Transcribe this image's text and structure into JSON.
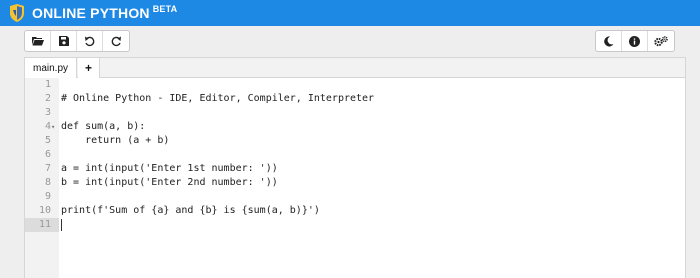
{
  "header": {
    "brand": "ONLINE PYTHON",
    "badge": "BETA",
    "accent_color": "#1e88e5"
  },
  "toolbar_left": {
    "buttons": [
      {
        "name": "open-folder-icon"
      },
      {
        "name": "save-icon"
      },
      {
        "name": "undo-icon"
      },
      {
        "name": "redo-icon"
      }
    ]
  },
  "toolbar_right": {
    "buttons": [
      {
        "name": "dark-mode-moon-icon"
      },
      {
        "name": "info-icon"
      },
      {
        "name": "settings-gears-icon"
      }
    ]
  },
  "tabs": {
    "file": "main.py",
    "add": "+"
  },
  "editor": {
    "lines": [
      {
        "n": "1",
        "text": ""
      },
      {
        "n": "2",
        "text": "# Online Python - IDE, Editor, Compiler, Interpreter"
      },
      {
        "n": "3",
        "text": ""
      },
      {
        "n": "4",
        "text": "def sum(a, b):"
      },
      {
        "n": "5",
        "text": "    return (a + b)"
      },
      {
        "n": "6",
        "text": ""
      },
      {
        "n": "7",
        "text": "a = int(input('Enter 1st number: '))"
      },
      {
        "n": "8",
        "text": "b = int(input('Enter 2nd number: '))"
      },
      {
        "n": "9",
        "text": ""
      },
      {
        "n": "10",
        "text": "print(f'Sum of {a} and {b} is {sum(a, b)}')"
      },
      {
        "n": "11",
        "text": ""
      }
    ],
    "active_line": "11"
  }
}
